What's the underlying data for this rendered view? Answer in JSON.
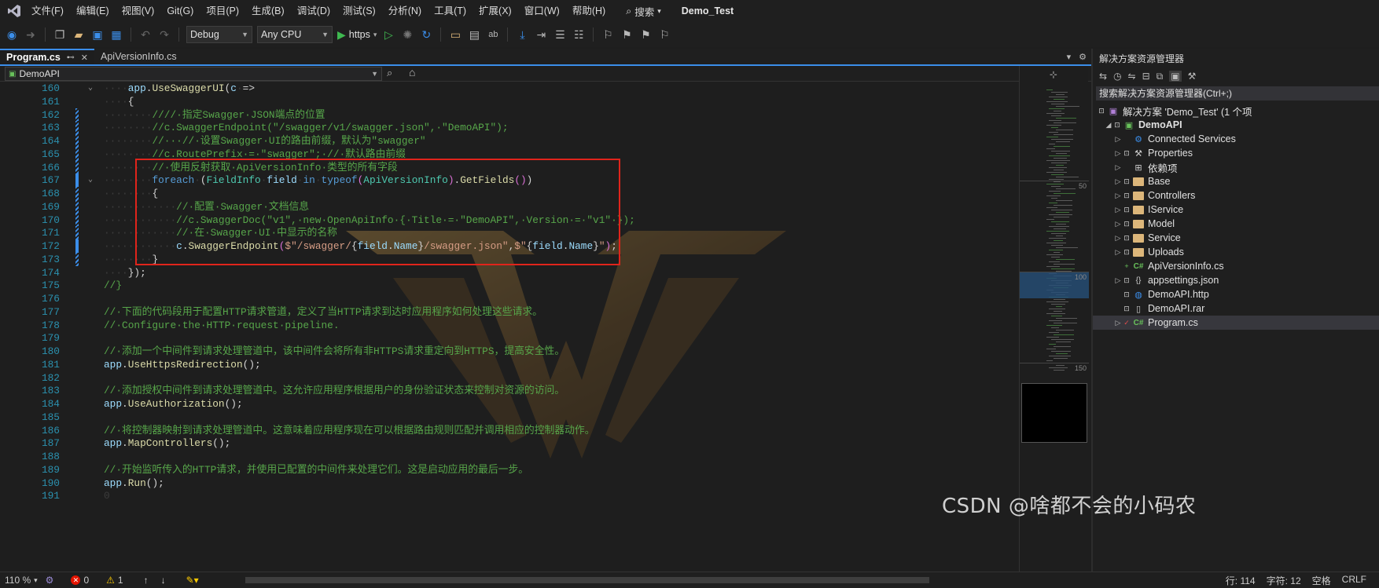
{
  "menubar": {
    "items": [
      "文件(F)",
      "编辑(E)",
      "视图(V)",
      "Git(G)",
      "项目(P)",
      "生成(B)",
      "调试(D)",
      "测试(S)",
      "分析(N)",
      "工具(T)",
      "扩展(X)",
      "窗口(W)",
      "帮助(H)"
    ],
    "search_label": "搜索",
    "solution_title": "Demo_Test"
  },
  "toolbar": {
    "config": "Debug",
    "platform": "Any CPU",
    "run_label": "https"
  },
  "tabs": [
    {
      "label": "Program.cs",
      "active": true
    },
    {
      "label": "ApiVersionInfo.cs",
      "active": false
    }
  ],
  "navbar": {
    "project": "DemoAPI"
  },
  "editor": {
    "lines": [
      {
        "n": "160",
        "html": "<span class='dot'>····</span><span class='v'>app</span><span class='p'>.</span><span class='m'>UseSwaggerUI</span><span class='p'>(</span><span class='v'>c</span><span class='dot'>·</span><span class='p'>=></span>"
      },
      {
        "n": "161",
        "html": "<span class='dot'>····</span><span class='p'>{</span>"
      },
      {
        "n": "162",
        "html": "<span class='dot'>········</span><span class='c'>////·指定Swagger·JSON端点的位置</span>"
      },
      {
        "n": "163",
        "html": "<span class='dot'>········</span><span class='c'>//c.SwaggerEndpoint(\"/swagger/v1/swagger.json\",·\"DemoAPI\");</span>"
      },
      {
        "n": "164",
        "html": "<span class='dot'>········</span><span class='c'>//···//·设置Swagger·UI的路由前缀，默认为\"swagger\"</span>"
      },
      {
        "n": "165",
        "html": "<span class='dot'>········</span><span class='c'>//c.RoutePrefix·=·\"swagger\";·//·默认路由前缀</span>"
      },
      {
        "n": "166",
        "html": "<span class='dot'>········</span><span class='c'>//·使用反射获取·ApiVersionInfo·类型的所有字段</span>"
      },
      {
        "n": "167",
        "html": "<span class='dot'>········</span><span class='k'>foreach</span><span class='dot'>·</span><span class='p'>(</span><span class='t'>FieldInfo</span><span class='dot'>·</span><span class='v'>field</span><span class='dot'>·</span><span class='k'>in</span><span class='dot'>·</span><span class='k'>typeof</span><span class='b'>(</span><span class='t'>ApiVersionInfo</span><span class='b'>)</span><span class='p'>.</span><span class='m'>GetFields</span><span class='b'>()</span><span class='p'>)</span>"
      },
      {
        "n": "168",
        "html": "<span class='dot'>········</span><span class='p'>{</span>"
      },
      {
        "n": "169",
        "html": "<span class='dot'>············</span><span class='c'>//·配置·Swagger·文档信息</span>"
      },
      {
        "n": "170",
        "html": "<span class='dot'>············</span><span class='c'>//c.SwaggerDoc(\"v1\",·new·OpenApiInfo·{·Title·=·\"DemoAPI\",·Version·=·\"v1\"·});</span>"
      },
      {
        "n": "171",
        "html": "<span class='dot'>············</span><span class='c'>//·在·Swagger·UI·中显示的名称</span>"
      },
      {
        "n": "172",
        "html": "<span class='dot'>············</span><span class='v'>c</span><span class='p'>.</span><span class='m'>SwaggerEndpoint</span><span class='b'>(</span><span class='s'>$\"/swagger/</span><span class='p'>{</span><span class='v'>field</span><span class='p'>.</span><span class='v'>Name</span><span class='p'>}</span><span class='s'>/swagger.json\"</span><span class='p'>,</span><span class='s'>$\"</span><span class='p'>{</span><span class='v'>field</span><span class='p'>.</span><span class='v'>Name</span><span class='p'>}</span><span class='s'>\"</span><span class='b'>)</span><span class='p'>;</span>"
      },
      {
        "n": "173",
        "html": "<span class='dot'>········</span><span class='p'>}</span>"
      },
      {
        "n": "174",
        "html": "<span class='dot'>····</span><span class='p'>});</span>"
      },
      {
        "n": "175",
        "html": "<span class='c'>//}</span>"
      },
      {
        "n": "176",
        "html": ""
      },
      {
        "n": "177",
        "html": "<span class='c'>//·下面的代码段用于配置HTTP请求管道，定义了当HTTP请求到达时应用程序如何处理这些请求。</span>"
      },
      {
        "n": "178",
        "html": "<span class='c'>//·Configure·the·HTTP·request·pipeline.</span>"
      },
      {
        "n": "179",
        "html": ""
      },
      {
        "n": "180",
        "html": "<span class='c'>//·添加一个中间件到请求处理管道中，该中间件会将所有非HTTPS请求重定向到HTTPS，提高安全性。</span>"
      },
      {
        "n": "181",
        "html": "<span class='v'>app</span><span class='p'>.</span><span class='m'>UseHttpsRedirection</span><span class='p'>();</span>"
      },
      {
        "n": "182",
        "html": ""
      },
      {
        "n": "183",
        "html": "<span class='c'>//·添加授权中间件到请求处理管道中。这允许应用程序根据用户的身份验证状态来控制对资源的访问。</span>"
      },
      {
        "n": "184",
        "html": "<span class='v'>app</span><span class='p'>.</span><span class='m'>UseAuthorization</span><span class='p'>();</span>"
      },
      {
        "n": "185",
        "html": ""
      },
      {
        "n": "186",
        "html": "<span class='c'>//·将控制器映射到请求处理管道中。这意味着应用程序现在可以根据路由规则匹配并调用相应的控制器动作。</span>"
      },
      {
        "n": "187",
        "html": "<span class='v'>app</span><span class='p'>.</span><span class='m'>MapControllers</span><span class='p'>();</span>"
      },
      {
        "n": "188",
        "html": ""
      },
      {
        "n": "189",
        "html": "<span class='c'>//·开始监听传入的HTTP请求，并使用已配置的中间件来处理它们。这是启动应用的最后一步。</span>"
      },
      {
        "n": "190",
        "html": "<span class='v'>app</span><span class='p'>.</span><span class='m'>Run</span><span class='p'>();</span>"
      },
      {
        "n": "191",
        "html": "<span class='dot'>0</span>"
      }
    ]
  },
  "minimap": {
    "marks": [
      "50",
      "100",
      "150"
    ]
  },
  "solution_explorer": {
    "title": "解决方案资源管理器",
    "search_placeholder": "搜索解决方案资源管理器(Ctrl+;)",
    "solution_label": "解决方案 'Demo_Test' (1 个项",
    "project": "DemoAPI",
    "items": [
      {
        "label": "Connected Services",
        "icon": "connected-services-icon"
      },
      {
        "label": "Properties",
        "icon": "properties-icon"
      },
      {
        "label": "依赖项",
        "icon": "dependencies-icon"
      },
      {
        "label": "Base",
        "icon": "folder-icon"
      },
      {
        "label": "Controllers",
        "icon": "folder-icon"
      },
      {
        "label": "IService",
        "icon": "folder-icon"
      },
      {
        "label": "Model",
        "icon": "folder-icon"
      },
      {
        "label": "Service",
        "icon": "folder-icon"
      },
      {
        "label": "Uploads",
        "icon": "folder-icon"
      },
      {
        "label": "ApiVersionInfo.cs",
        "icon": "csharp-file-icon"
      },
      {
        "label": "appsettings.json",
        "icon": "json-file-icon"
      },
      {
        "label": "DemoAPI.http",
        "icon": "http-file-icon"
      },
      {
        "label": "DemoAPI.rar",
        "icon": "file-icon"
      },
      {
        "label": "Program.cs",
        "icon": "csharp-file-icon"
      }
    ]
  },
  "statusbar": {
    "zoom": "110 %",
    "errors": "0",
    "warnings": "1",
    "line": "行: 114",
    "col": "字符: 12",
    "spaces": "空格",
    "eol": "CRLF"
  },
  "watermark_text": "CSDN @啥都不会的小码农"
}
